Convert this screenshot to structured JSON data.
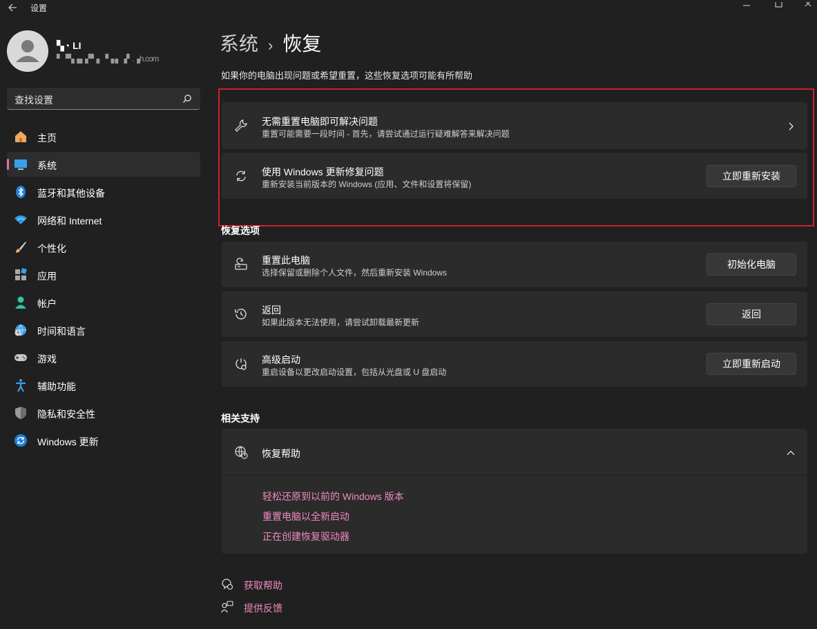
{
  "window": {
    "title": "设置"
  },
  "profile": {
    "name": "▚◔ LI",
    "email": "▘▝▚▗▖▞▘▖▝▗.▖▗▘.▗h.com"
  },
  "search": {
    "placeholder": "查找设置"
  },
  "sidebar": {
    "items": [
      {
        "label": "主页",
        "icon": "home-icon"
      },
      {
        "label": "系统",
        "icon": "system-icon",
        "active": true
      },
      {
        "label": "蓝牙和其他设备",
        "icon": "bluetooth-icon"
      },
      {
        "label": "网络和 Internet",
        "icon": "wifi-icon"
      },
      {
        "label": "个性化",
        "icon": "brush-icon"
      },
      {
        "label": "应用",
        "icon": "apps-icon"
      },
      {
        "label": "帐户",
        "icon": "account-icon"
      },
      {
        "label": "时间和语言",
        "icon": "globe-clock-icon"
      },
      {
        "label": "游戏",
        "icon": "gamepad-icon"
      },
      {
        "label": "辅助功能",
        "icon": "accessibility-icon"
      },
      {
        "label": "隐私和安全性",
        "icon": "shield-icon"
      },
      {
        "label": "Windows 更新",
        "icon": "update-icon"
      }
    ],
    "accent": "#e86fa8"
  },
  "main": {
    "breadcrumb": {
      "parent": "系统",
      "separator": "›",
      "current": "恢复"
    },
    "subtitle": "如果你的电脑出现问题或希望重置，这些恢复选项可能有所帮助",
    "top_cards": [
      {
        "title": "无需重置电脑即可解决问题",
        "desc": "重置可能需要一段时间 - 首先，请尝试通过运行疑难解答来解决问题",
        "icon": "wrench-icon"
      },
      {
        "title": "使用 Windows 更新修复问题",
        "desc": "重新安装当前版本的 Windows (应用、文件和设置将保留)",
        "button": "立即重新安装",
        "icon": "refresh-icon"
      }
    ],
    "recovery_section_title": "恢复选项",
    "recovery_options": [
      {
        "title": "重置此电脑",
        "desc": "选择保留或删除个人文件，然后重新安装 Windows",
        "button": "初始化电脑",
        "icon": "reset-pc-icon"
      },
      {
        "title": "返回",
        "desc": "如果此版本无法使用，请尝试卸载最新更新",
        "button": "返回",
        "icon": "history-icon"
      },
      {
        "title": "高级启动",
        "desc": "重启设备以更改启动设置，包括从光盘或 U 盘启动",
        "button": "立即重新启动",
        "icon": "advanced-startup-icon"
      }
    ],
    "related_section_title": "相关支持",
    "help_panel": {
      "title": "恢复帮助",
      "icon": "globe-help-icon",
      "links": [
        "轻松还原到以前的 Windows 版本",
        "重置电脑以全新启动",
        "正在创建恢复驱动器"
      ]
    },
    "footer": {
      "get_help": "获取帮助",
      "feedback": "提供反馈"
    },
    "link_color": "#f08bc0",
    "highlight_color": "#d0202a"
  }
}
